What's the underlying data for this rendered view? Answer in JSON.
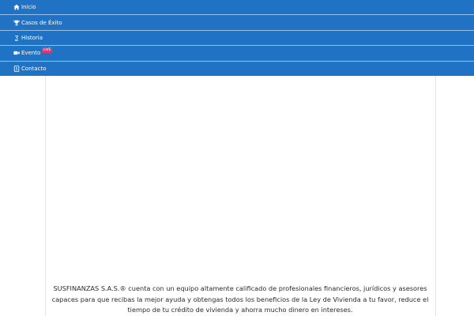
{
  "nav": {
    "items": [
      {
        "label": "Inicio",
        "icon": "home-icon"
      },
      {
        "label": "Casos de Éxito",
        "icon": "trophy-icon"
      },
      {
        "label": "Historia",
        "icon": "history-icon"
      },
      {
        "label": "Evento",
        "icon": "video-camera-icon",
        "badge": "LIVE"
      },
      {
        "label": "Contacto",
        "icon": "contact-book-icon"
      }
    ]
  },
  "colors": {
    "nav_bg": "#1f72c4",
    "badge_bg": "#e8336d",
    "text": "#2c2c2c"
  },
  "main": {
    "description": "SUSFINANZAS S.A.S.® cuenta con un equipo altamente calificado de profesionales financieros, jurídicos y asesores capaces para que recibas la mejor ayuda y obtengas todos los beneficios de la Ley de Vivienda a tu favor, reduce el tiempo de tu crédito de vivienda y ahorra mucho dinero en intereses."
  }
}
